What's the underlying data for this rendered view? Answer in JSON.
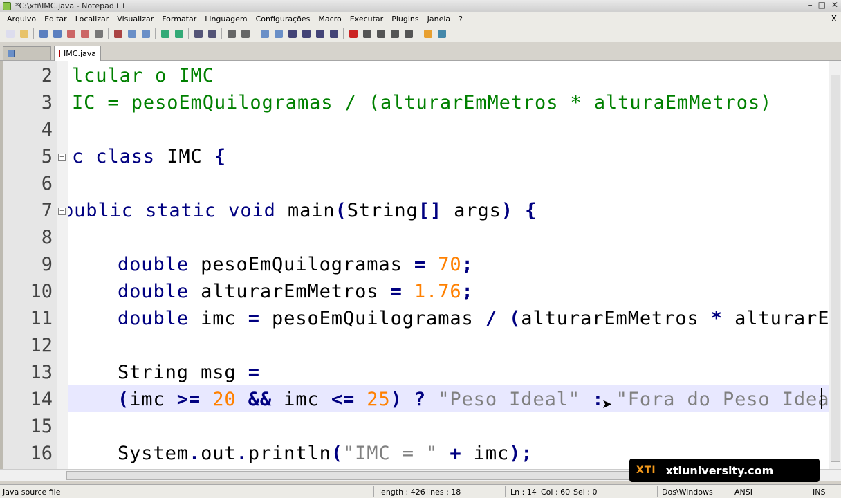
{
  "window": {
    "title": "*C:\\xti\\IMC.java - Notepad++",
    "min": "–",
    "max": "□",
    "close": "✕"
  },
  "menu": [
    "Arquivo",
    "Editar",
    "Localizar",
    "Visualizar",
    "Formatar",
    "Linguagem",
    "Configurações",
    "Macro",
    "Executar",
    "Plugins",
    "Janela",
    "?"
  ],
  "menu_close": "X",
  "tabs": [
    {
      "label": ""
    },
    {
      "label": "IMC.java"
    }
  ],
  "toolbar_icons": [
    "new-file-icon",
    "open-icon",
    "save-icon",
    "save-all-icon",
    "close-icon",
    "close-all-icon",
    "print-icon",
    "cut-icon",
    "copy-icon",
    "paste-icon",
    "undo-icon",
    "redo-icon",
    "find-icon",
    "replace-icon",
    "zoom-in-icon",
    "zoom-out-icon",
    "sync-v-icon",
    "sync-h-icon",
    "wrap-icon",
    "all-chars-icon",
    "indent-guide-icon",
    "doc-map-icon",
    "record-icon",
    "stop-icon",
    "play-icon",
    "play-multi-icon",
    "save-macro-icon",
    "run-icon",
    "spell-icon"
  ],
  "code": {
    "lines": [
      "2",
      "3",
      "4",
      "5",
      "6",
      "7",
      "8",
      "9",
      "10",
      "11",
      "12",
      "13",
      "14",
      "15",
      "16"
    ]
  },
  "statusbar": {
    "type": "Java source file",
    "length": "length : 426",
    "lines": "lines : 18",
    "ln": "Ln : 14",
    "col": "Col : 60",
    "sel": "Sel : 0",
    "eol": "Dos\\Windows",
    "encoding": "ANSI",
    "mode": "INS"
  },
  "watermark": {
    "logo": "XTI",
    "text": "xtiuniversity.com"
  }
}
